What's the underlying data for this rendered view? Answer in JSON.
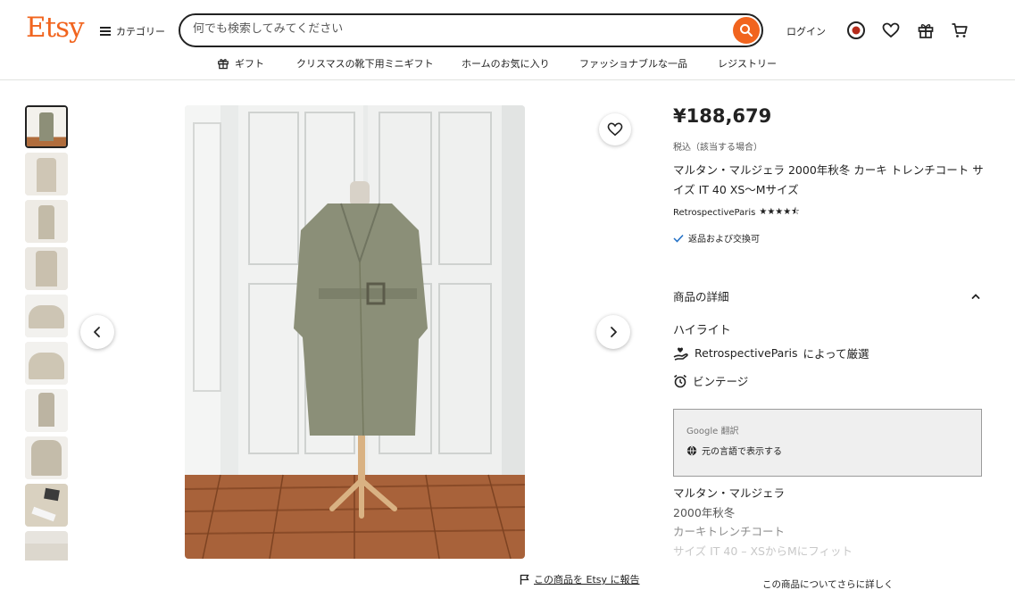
{
  "header": {
    "logo": "Etsy",
    "categories_label": "カテゴリー",
    "search_placeholder": "何でも検索してみてください",
    "login_label": "ログイン"
  },
  "nav": [
    {
      "label": "ギフト",
      "icon": "gift-icon"
    },
    {
      "label": "クリスマスの靴下用ミニギフト"
    },
    {
      "label": "ホームのお気に入り"
    },
    {
      "label": "ファッショナブルな一品"
    },
    {
      "label": "レジストリー"
    }
  ],
  "gallery": {
    "thumbnail_count": 10,
    "active_index": 0,
    "prev_icon": "chevron-left-icon",
    "next_icon": "chevron-right-icon",
    "favorite_icon": "heart-icon"
  },
  "report": {
    "label": "この商品を Etsy に報告",
    "icon": "flag-icon"
  },
  "product": {
    "price": "¥188,679",
    "tax_note": "税込（該当する場合）",
    "title": "マルタン・マルジェラ 2000年秋冬 カーキ トレンチコート サイズ IT 40 XS〜Mサイズ",
    "shop_name": "RetrospectiveParis",
    "rating": 4.5,
    "stars_text": "★★★★⯪",
    "returns_label": "返品および交換可"
  },
  "details": {
    "heading": "商品の詳細",
    "highlights_heading": "ハイライト",
    "curated_shop": "RetrospectiveParis",
    "curated_suffix": "によって厳選",
    "vintage_label": "ビンテージ"
  },
  "google_translate": {
    "label": "Google 翻訳",
    "show_original": "元の言語で表示する"
  },
  "description": [
    "マルタン・マルジェラ",
    "2000年秋冬",
    "カーキトレンチコート",
    "サイズ IT 40 – XSからMにフィット"
  ],
  "learn_more": "この商品についてさらに詳しく",
  "colors": {
    "brand": "#f1641e",
    "text": "#222222"
  }
}
